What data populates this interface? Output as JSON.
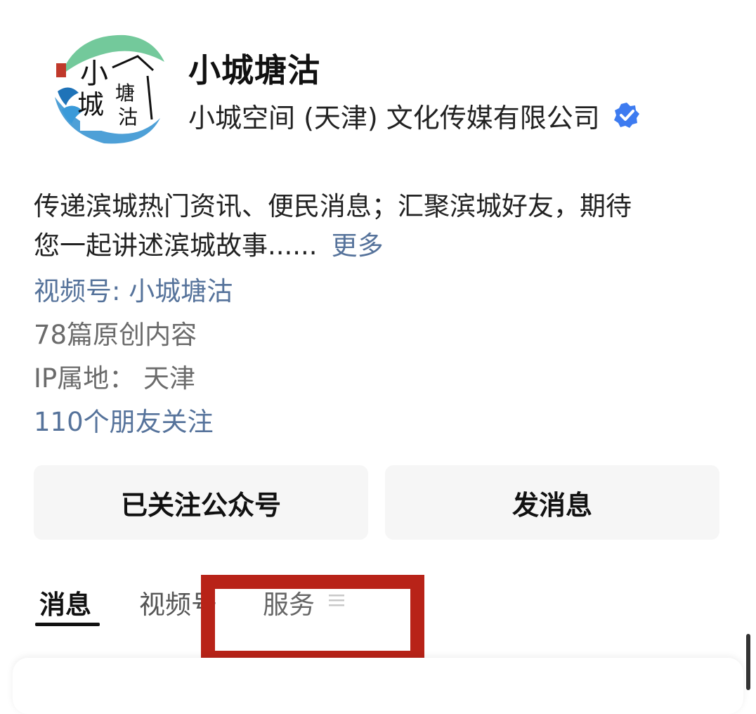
{
  "profile": {
    "logo_icon": "brand-logo-calligraphy-wave",
    "name": "小城塘沽",
    "company": "小城空间 (天津) 文化传媒有限公司",
    "verified_icon": "verified-badge-icon"
  },
  "description": {
    "line1": "传递滨城热门资讯、便民消息；汇聚滨城好友，期待",
    "line2": "您一起讲述滨城故事......",
    "more_label": "更多"
  },
  "info": {
    "channel": "视频号: 小城塘沽",
    "original_count": "78篇原创内容",
    "ip_location": "IP属地： 天津",
    "friends_following": "110个朋友关注"
  },
  "actions": {
    "follow_label": "已关注公众号",
    "message_label": "发消息"
  },
  "tabs": [
    {
      "label": "消息",
      "active": true
    },
    {
      "label": "视频号",
      "active": false
    },
    {
      "label": "服务",
      "active": false,
      "icon": "menu-lines-icon"
    }
  ],
  "colors": {
    "link": "#56739b",
    "highlight_border": "#b82318",
    "verified_blue": "#3d7bf0",
    "button_bg": "#f6f6f6"
  }
}
